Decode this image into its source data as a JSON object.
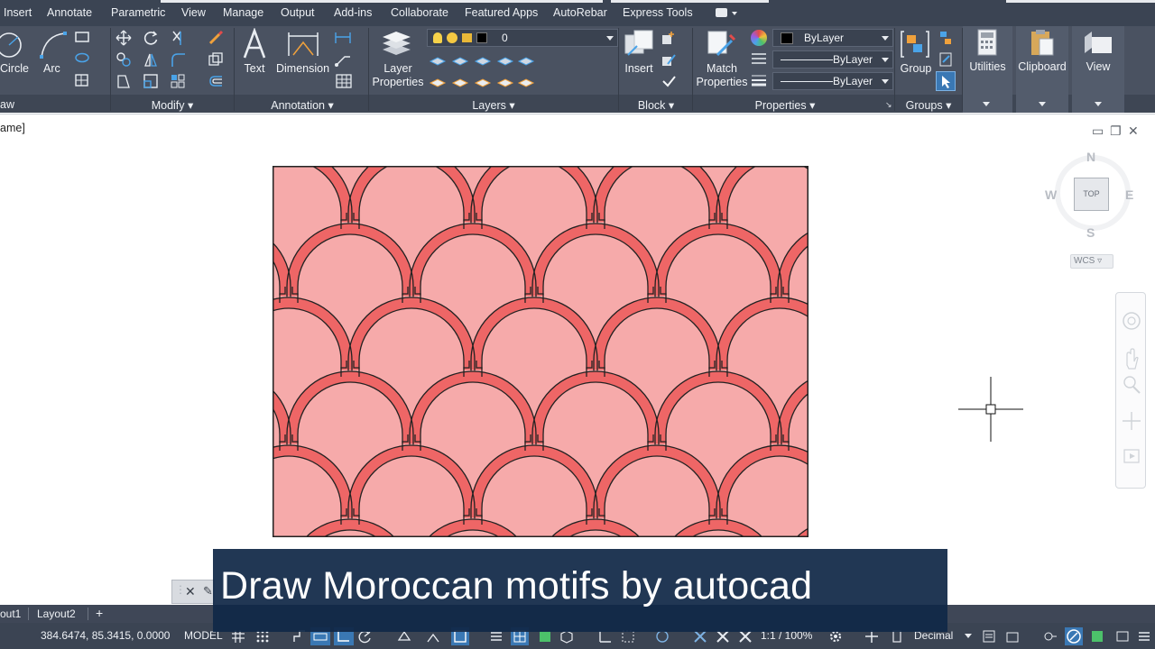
{
  "menu": {
    "items": [
      "Insert",
      "Annotate",
      "Parametric",
      "View",
      "Manage",
      "Output",
      "Add-ins",
      "Collaborate",
      "Featured Apps",
      "AutoRebar",
      "Express Tools"
    ]
  },
  "ribbon": {
    "draw": {
      "circle_label": "Circle",
      "arc_label": "Arc",
      "panel_title": "aw"
    },
    "modify": {
      "panel_title": "Modify"
    },
    "annotation": {
      "text_label": "Text",
      "dimension_label": "Dimension",
      "panel_title": "Annotation"
    },
    "layers": {
      "layer_properties_line1": "Layer",
      "layer_properties_line2": "Properties",
      "current_layer": "0",
      "panel_title": "Layers"
    },
    "block": {
      "insert_label": "Insert",
      "panel_title": "Block"
    },
    "properties": {
      "match_line1": "Match",
      "match_line2": "Properties",
      "color_value": "ByLayer",
      "linetype_value": "ByLayer",
      "lineweight_value": "ByLayer",
      "panel_title": "Properties"
    },
    "groups": {
      "group_label": "Group",
      "panel_title": "Groups"
    },
    "utilities_label": "Utilities",
    "clipboard_label": "Clipboard",
    "view_label": "View"
  },
  "viewport": {
    "label": "ame]"
  },
  "viewcube": {
    "north": "N",
    "south": "S",
    "east": "E",
    "west": "W",
    "top_face": "TOP",
    "wcs_label": "WCS"
  },
  "layout_tabs": {
    "tab1": "out1",
    "tab2": "Layout2",
    "add": "+"
  },
  "status": {
    "coordinates": "384.6474, 85.3415, 0.0000",
    "space": "MODEL",
    "scale": "1:1 / 100%",
    "units": "Decimal"
  },
  "banner": {
    "text": "Draw Moroccan motifs by autocad"
  },
  "colors": {
    "pattern_fill": "#f6aaaa",
    "pattern_band": "#ee6666",
    "outline": "#222222",
    "banner_bg": "#102847",
    "ribbon_bg": "#4a5261",
    "menubar_bg": "#3b4453"
  }
}
